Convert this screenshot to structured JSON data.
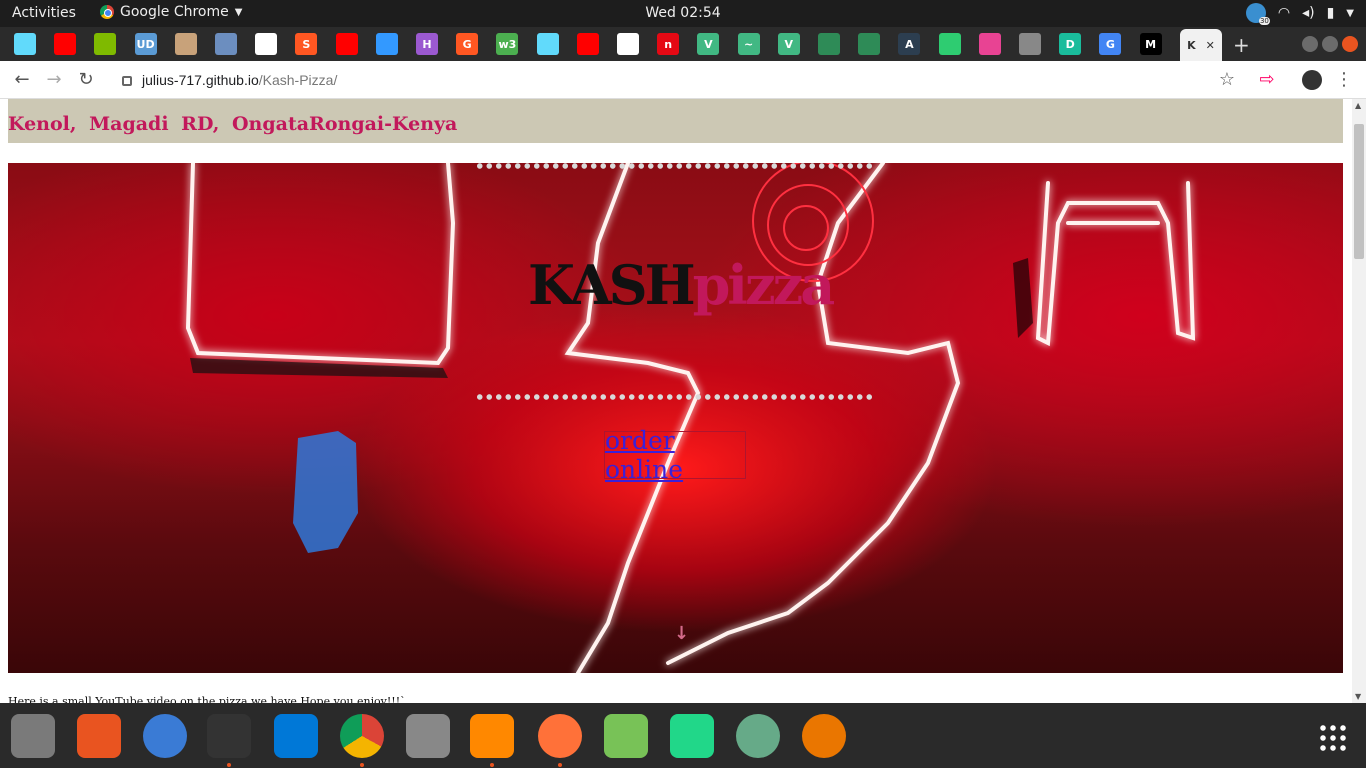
{
  "system_bar": {
    "activities": "Activities",
    "app_name": "Google Chrome",
    "clock": "Wed 02:54",
    "badge": "30"
  },
  "tabs": [
    {
      "icon": "react-icon",
      "color": "#61dafb",
      "label": ""
    },
    {
      "icon": "youtube-icon",
      "color": "#ff0000",
      "label": ""
    },
    {
      "icon": "microsoft-icon",
      "color": "#7fba00",
      "label": ""
    },
    {
      "icon": "udemy-icon",
      "color": "#5b9bd5",
      "label": "UD"
    },
    {
      "icon": "avatar-icon",
      "color": "#c8a27a",
      "label": ""
    },
    {
      "icon": "docs-icon",
      "color": "#6c8ebf",
      "label": ""
    },
    {
      "icon": "github-icon",
      "color": "#ffffff",
      "label": ""
    },
    {
      "icon": "stackblitz-icon",
      "color": "#ff5722",
      "label": "S"
    },
    {
      "icon": "youtube-icon",
      "color": "#ff0000",
      "label": ""
    },
    {
      "icon": "pen-icon",
      "color": "#3399ff",
      "label": ""
    },
    {
      "icon": "heroku-icon",
      "color": "#9b59d0",
      "label": "H"
    },
    {
      "icon": "app-icon",
      "color": "#ff5722",
      "label": "G"
    },
    {
      "icon": "w3-icon",
      "color": "#4caf50",
      "label": "w3"
    },
    {
      "icon": "react-icon",
      "color": "#61dafb",
      "label": ""
    },
    {
      "icon": "youtube-icon",
      "color": "#ff0000",
      "label": ""
    },
    {
      "icon": "github-icon",
      "color": "#ffffff",
      "label": ""
    },
    {
      "icon": "netflix-icon",
      "color": "#e50914",
      "label": "n"
    },
    {
      "icon": "vue-icon",
      "color": "#41b883",
      "label": "V"
    },
    {
      "icon": "vue-icon",
      "color": "#41b883",
      "label": "~"
    },
    {
      "icon": "vue-icon",
      "color": "#41b883",
      "label": "V"
    },
    {
      "icon": "hex-icon",
      "color": "#2e8b57",
      "label": ""
    },
    {
      "icon": "hex-icon",
      "color": "#2e8b57",
      "label": ""
    },
    {
      "icon": "code-icon",
      "color": "#2c3e50",
      "label": "A"
    },
    {
      "icon": "leaf-icon",
      "color": "#2ecc71",
      "label": ""
    },
    {
      "icon": "unicorn-icon",
      "color": "#e84393",
      "label": ""
    },
    {
      "icon": "globe-icon",
      "color": "#888888",
      "label": ""
    },
    {
      "icon": "doc-icon",
      "color": "#1abc9c",
      "label": "D"
    },
    {
      "icon": "google-icon",
      "color": "#4285f4",
      "label": "G"
    },
    {
      "icon": "medium-icon",
      "color": "#000000",
      "label": "M"
    },
    {
      "icon": "active-tab",
      "color": "#f1f1f1",
      "label": "K"
    }
  ],
  "address": {
    "host": "julius-717.github.io",
    "path": "/Kash-Pizza/"
  },
  "page": {
    "address_line": "Kenol, Magadi RD, OngataRongai-Kenya",
    "logo_main": "KASH",
    "logo_accent": "pizza",
    "order_link": "order online",
    "caption": "Here is a small YouTube video on the pizza we have Hope you enjoy!!!`"
  },
  "dock": [
    {
      "icon": "files-icon",
      "color": "#7a7a7a"
    },
    {
      "icon": "software-icon",
      "color": "#e95420"
    },
    {
      "icon": "help-icon",
      "color": "#3a7bd5"
    },
    {
      "icon": "terminal-icon",
      "color": "#333333"
    },
    {
      "icon": "vscode-icon",
      "color": "#0078d7"
    },
    {
      "icon": "chrome-icon",
      "color": "#4285f4"
    },
    {
      "icon": "settings-icon",
      "color": "#888888"
    },
    {
      "icon": "vlc-icon",
      "color": "#ff8800"
    },
    {
      "icon": "firefox-icon",
      "color": "#ff7139"
    },
    {
      "icon": "android-studio-icon",
      "color": "#78c257"
    },
    {
      "icon": "pycharm-icon",
      "color": "#21d789"
    },
    {
      "icon": "atom-icon",
      "color": "#66aa88"
    },
    {
      "icon": "blender-icon",
      "color": "#ea7600"
    }
  ]
}
